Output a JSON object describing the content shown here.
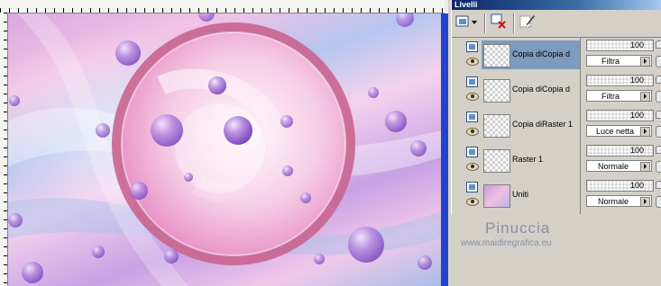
{
  "panel": {
    "title": "Livelli"
  },
  "layers": [
    {
      "name": "Copia diCopia d",
      "selected": true
    },
    {
      "name": "Copia diCopia d",
      "selected": false
    },
    {
      "name": "Copia diRaster 1",
      "selected": false
    },
    {
      "name": "Raster 1",
      "selected": false
    },
    {
      "name": "Uniti",
      "selected": false
    }
  ],
  "properties": [
    {
      "opacity": "100",
      "blend": "Filtra"
    },
    {
      "opacity": "100",
      "blend": "Filtra"
    },
    {
      "opacity": "100",
      "blend": "Luce netta"
    },
    {
      "opacity": "100",
      "blend": "Normale"
    },
    {
      "opacity": "100",
      "blend": "Normale"
    }
  ],
  "watermark": {
    "name": "Pinuccia",
    "url": "www.maidiregrafica.eu"
  },
  "icons": {
    "new_layer": "new-layer-icon",
    "delete_layer": "delete-layer-icon",
    "edit_layer": "edit-layer-icon"
  }
}
